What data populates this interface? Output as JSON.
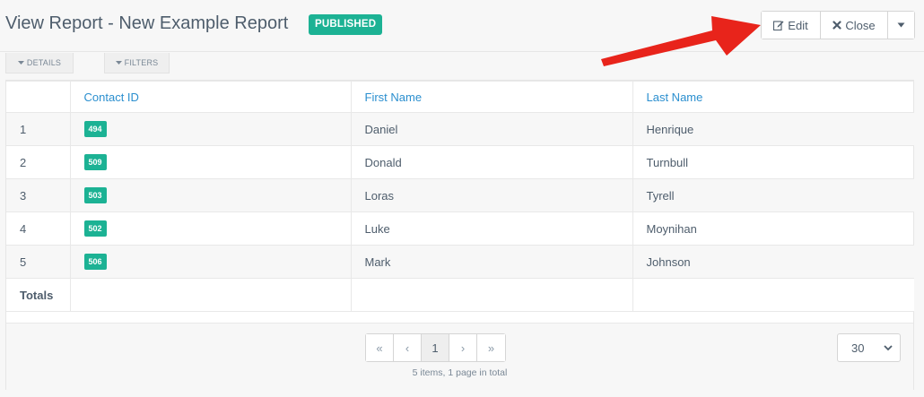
{
  "header": {
    "title": "View Report - New Example Report",
    "status": "PUBLISHED",
    "actions": {
      "edit_label": "Edit",
      "close_label": "Close"
    }
  },
  "tabs": {
    "details": "DETAILS",
    "filters": "FILTERS"
  },
  "table": {
    "columns": [
      "",
      "Contact ID",
      "First Name",
      "Last Name"
    ],
    "rows": [
      {
        "num": "1",
        "contact_id": "494",
        "first_name": "Daniel",
        "last_name": "Henrique"
      },
      {
        "num": "2",
        "contact_id": "509",
        "first_name": "Donald",
        "last_name": "Turnbull"
      },
      {
        "num": "3",
        "contact_id": "503",
        "first_name": "Loras",
        "last_name": "Tyrell"
      },
      {
        "num": "4",
        "contact_id": "502",
        "first_name": "Luke",
        "last_name": "Moynihan"
      },
      {
        "num": "5",
        "contact_id": "506",
        "first_name": "Mark",
        "last_name": "Johnson"
      }
    ],
    "totals_label": "Totals"
  },
  "pagination": {
    "first": "«",
    "prev": "‹",
    "current": "1",
    "next": "›",
    "last": "»",
    "summary": "5 items, 1 page in total",
    "limit": "30"
  },
  "colors": {
    "accent": "#1cb294",
    "link": "#2b8fcf",
    "arrow": "#e8241b"
  },
  "icons": {
    "edit": "edit-icon",
    "close": "times-icon",
    "caret": "caret-down-icon"
  }
}
